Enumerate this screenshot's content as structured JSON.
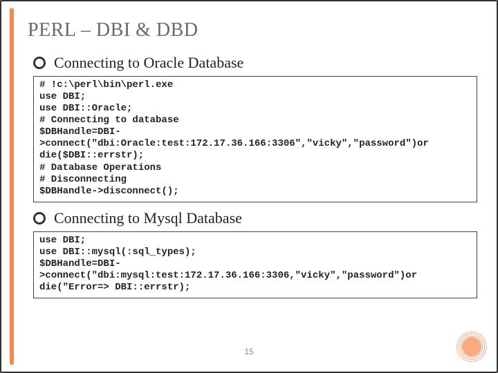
{
  "slide": {
    "title": "PERL – DBI & DBD",
    "bullets": [
      {
        "text": "Connecting to Oracle Database"
      },
      {
        "text": "Connecting to Mysql Database"
      }
    ],
    "code_blocks": [
      "# !c:\\perl\\bin\\perl.exe\nuse DBI;\nuse DBI::Oracle;\n# Connecting to database\n$DBHandle=DBI->connect(\"dbi:Oracle:test:172.17.36.166:3306\",\"vicky\",\"password\")or die($DBI::errstr);\n# Database Operations\n# Disconnecting\n$DBHandle->disconnect();",
      "use DBI;\nuse DBI::mysql(:sql_types);\n$DBHandle=DBI->connect(\"dbi:mysql:test:172.17.36.166:3306,\"vicky\",\"password\")or die(\"Error=> DBI::errstr);"
    ],
    "page_number": "15"
  }
}
